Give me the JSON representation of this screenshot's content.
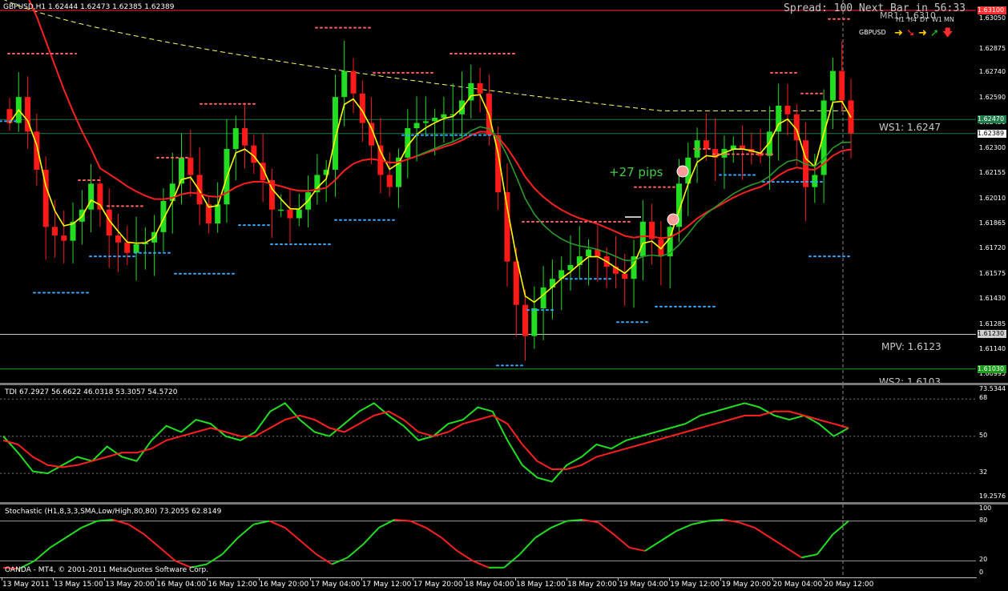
{
  "main": {
    "header": "GBPUSD,H1  1.62444 1.62473 1.62385 1.62389",
    "spread": "Spread: 100 Next Bar in 56:33",
    "mr1": "MR1: 1.6310",
    "tf_labels": [
      "H1",
      "H4",
      "DY",
      "W1",
      "MN"
    ],
    "symbol": "GBPUSD",
    "arrows": [
      {
        "glyph": "➜",
        "color": "#ffcc00"
      },
      {
        "glyph": "➘",
        "color": "#ff2a2a"
      },
      {
        "glyph": "➜",
        "color": "#ffcc00"
      },
      {
        "glyph": "➚",
        "color": "#22c322"
      },
      {
        "glyph": "🡇",
        "color": "#ff2a2a"
      }
    ],
    "pips_label": "+27 pips",
    "levels": {
      "ws1": "WS1: 1.6247",
      "mpv": "MPV: 1.6123",
      "ws2": "WS2: 1.6103"
    },
    "price_ticks": [
      "1.63050",
      "1.62875",
      "1.62740",
      "1.62590",
      "1.62450",
      "1.62300",
      "1.62155",
      "1.62010",
      "1.61865",
      "1.61720",
      "1.61575",
      "1.61430",
      "1.61285",
      "1.61140",
      "1.60995"
    ],
    "price_boxes": [
      {
        "label": "1.63100",
        "color": "#ff3030"
      },
      {
        "label": "1.62470",
        "color": "#1f7a4a"
      },
      {
        "label": "1.62389",
        "color": "#ffffff"
      },
      {
        "label": "1.61230",
        "color": "#d0d0d0"
      },
      {
        "label": "1.61030",
        "color": "#1b9a1b"
      }
    ]
  },
  "tdi": {
    "header": "TDI 67.2927 56.6622 46.0318 53.3057 54.5720",
    "ticks": [
      "73.5344",
      "68",
      "50",
      "32",
      "19.2576"
    ]
  },
  "stoch": {
    "header": "Stochastic (H1,8,3,3,SMA,Low/High,80,80) 73.2055 62.8149",
    "ticks": [
      "100",
      "80",
      "20",
      "0"
    ]
  },
  "footer": "OANDA - MT4, © 2001-2011 MetaQuotes Software Corp.",
  "colors": {
    "bull": "#22dd22",
    "bear": "#ff1a1a",
    "ema_fast": "#ffff00",
    "ema_slow": "#ff2020",
    "sma_long": "#ffff66",
    "trend": "#2a9a2a"
  },
  "chart_data": {
    "type": "line",
    "title": "GBPUSD,H1",
    "x_labels": [
      "13 May 2011",
      "13 May 15:00",
      "13 May 20:00",
      "16 May 04:00",
      "16 May 12:00",
      "16 May 20:00",
      "17 May 04:00",
      "17 May 12:00",
      "17 May 20:00",
      "18 May 04:00",
      "18 May 12:00",
      "18 May 20:00",
      "19 May 04:00",
      "19 May 12:00",
      "19 May 20:00",
      "20 May 04:00",
      "20 May 12:00"
    ],
    "price": {
      "ylim": [
        1.6095,
        1.6316
      ],
      "closes": [
        1.6245,
        1.626,
        1.624,
        1.6218,
        1.6185,
        1.618,
        1.6177,
        1.6188,
        1.6195,
        1.621,
        1.6195,
        1.618,
        1.6176,
        1.617,
        1.6175,
        1.6176,
        1.6182,
        1.62,
        1.621,
        1.6225,
        1.6215,
        1.6198,
        1.6187,
        1.6198,
        1.623,
        1.6242,
        1.6232,
        1.6222,
        1.6212,
        1.6195,
        1.6195,
        1.619,
        1.6195,
        1.6205,
        1.6215,
        1.6218,
        1.626,
        1.6275,
        1.6262,
        1.6245,
        1.6232,
        1.6215,
        1.6208,
        1.6225,
        1.6242,
        1.6245,
        1.6246,
        1.6248,
        1.625,
        1.625,
        1.6258,
        1.6268,
        1.6262,
        1.6238,
        1.6205,
        1.6165,
        1.614,
        1.6122,
        1.6138,
        1.615,
        1.6155,
        1.616,
        1.6163,
        1.6168,
        1.6172,
        1.6168,
        1.6162,
        1.6158,
        1.6155,
        1.6168,
        1.6188,
        1.6178,
        1.6168,
        1.6185,
        1.621,
        1.6225,
        1.6235,
        1.623,
        1.6225,
        1.623,
        1.6232,
        1.623,
        1.6228,
        1.6226,
        1.624,
        1.6255,
        1.625,
        1.6235,
        1.6208,
        1.6215,
        1.6258,
        1.6275,
        1.6258,
        1.6239
      ],
      "levels": {
        "MR1": 1.631,
        "WS1": 1.6247,
        "MPV": 1.6123,
        "WS2": 1.6103,
        "current": 1.62389
      }
    },
    "tdi": {
      "ylim": [
        19.2576,
        73.5344
      ],
      "levels": [
        68,
        50,
        32
      ],
      "green": [
        50,
        42,
        33,
        32,
        36,
        40,
        38,
        45,
        40,
        38,
        48,
        55,
        52,
        58,
        56,
        50,
        48,
        52,
        62,
        66,
        58,
        52,
        50,
        56,
        62,
        66,
        60,
        55,
        48,
        50,
        56,
        58,
        64,
        62,
        48,
        36,
        30,
        28,
        36,
        40,
        46,
        44,
        48,
        50,
        52,
        54,
        56,
        60,
        62,
        64,
        66,
        64,
        60,
        58,
        60,
        56,
        50,
        54
      ],
      "red": [
        48,
        46,
        40,
        36,
        35,
        36,
        38,
        40,
        42,
        42,
        44,
        48,
        50,
        52,
        54,
        52,
        50,
        50,
        54,
        58,
        60,
        58,
        54,
        52,
        56,
        60,
        62,
        58,
        52,
        50,
        52,
        56,
        58,
        60,
        56,
        46,
        38,
        34,
        34,
        36,
        40,
        42,
        44,
        46,
        48,
        50,
        52,
        54,
        56,
        58,
        60,
        60,
        62,
        62,
        60,
        58,
        56,
        54
      ]
    },
    "stochastic": {
      "ylim": [
        0,
        100
      ],
      "levels": [
        80,
        20
      ],
      "k": [
        10,
        8,
        20,
        40,
        55,
        70,
        80,
        82,
        75,
        60,
        40,
        20,
        10,
        15,
        30,
        55,
        75,
        80,
        70,
        50,
        30,
        15,
        25,
        45,
        70,
        82,
        80,
        70,
        55,
        35,
        20,
        10,
        10,
        30,
        55,
        70,
        80,
        82,
        78,
        60,
        40,
        35,
        50,
        65,
        75,
        80,
        82,
        78,
        70,
        55,
        40,
        25,
        30,
        60,
        80
      ],
      "d": [
        12,
        10,
        15,
        30,
        48,
        62,
        75,
        80,
        78,
        66,
        48,
        30,
        15,
        14,
        25,
        45,
        65,
        76,
        74,
        58,
        38,
        22,
        22,
        38,
        60,
        76,
        80,
        74,
        60,
        42,
        26,
        14,
        10,
        22,
        45,
        62,
        74,
        80,
        80,
        66,
        48,
        38,
        46,
        60,
        70,
        78,
        80,
        80,
        72,
        60,
        46,
        32,
        30,
        50,
        72
      ]
    }
  }
}
